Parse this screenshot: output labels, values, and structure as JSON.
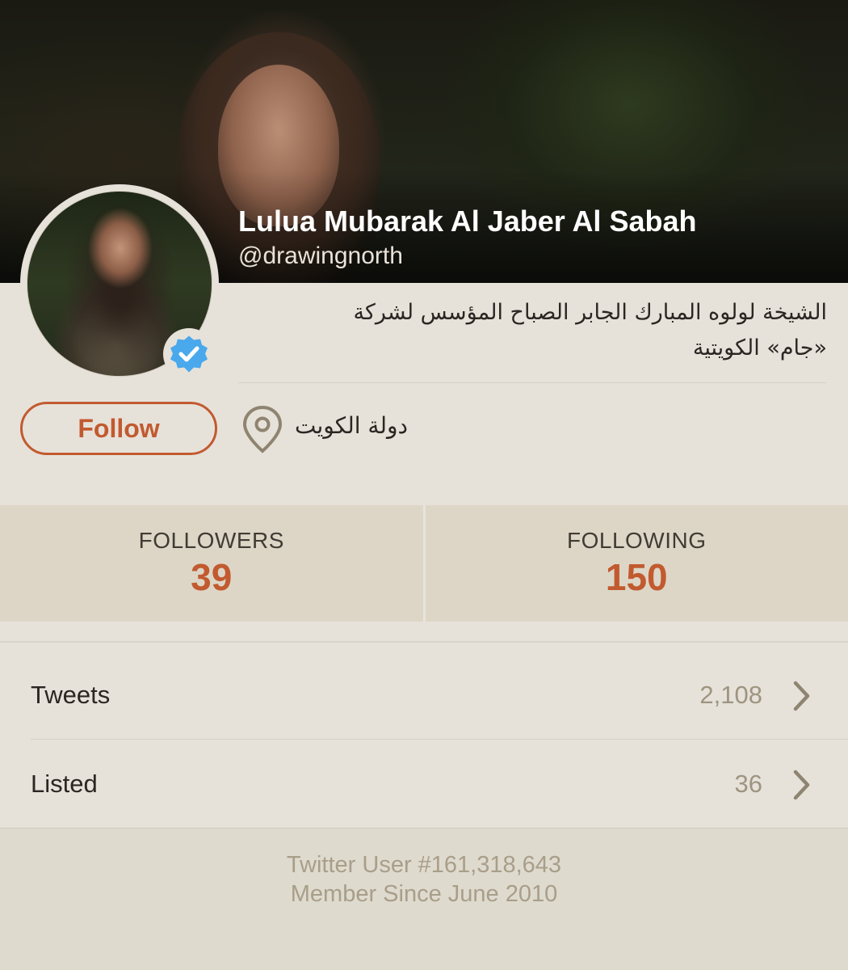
{
  "profile": {
    "name": "Lulua Mubarak Al Jaber Al Sabah",
    "handle": "@drawingnorth",
    "verified_icon": "verified-badge-icon",
    "bio_line1": "الشيخة لولوه المبارك الجابر الصباح المؤسس لشركة",
    "bio_line2": "«جام» الكويتية",
    "location": "دولة الكويت",
    "location_icon": "location-pin-icon"
  },
  "actions": {
    "follow_label": "Follow"
  },
  "stats": {
    "followers_label": "FOLLOWERS",
    "followers_value": "39",
    "following_label": "FOLLOWING",
    "following_value": "150"
  },
  "list": {
    "tweets_label": "Tweets",
    "tweets_count": "2,108",
    "listed_label": "Listed",
    "listed_count": "36"
  },
  "footer": {
    "user_number": "Twitter User #161,318,643",
    "member_since": "Member Since June 2010"
  },
  "colors": {
    "accent": "#c25a2f",
    "background": "#e6e2da",
    "stats_background": "#ddd6c7",
    "muted_text": "#a89e8a",
    "verified_blue": "#4aa8ec"
  }
}
